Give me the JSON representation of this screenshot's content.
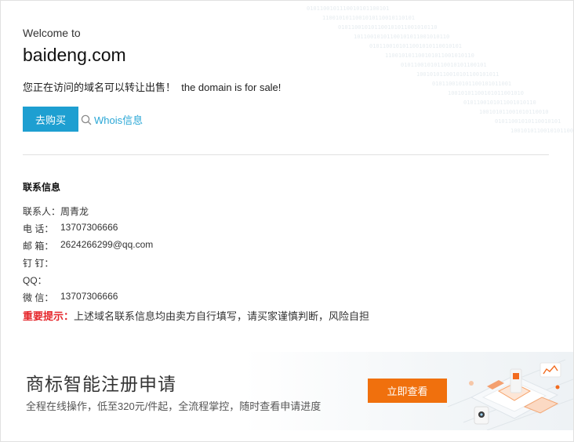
{
  "welcome": "Welcome to",
  "domain": "baideng.com",
  "sale_text": "您正在访问的域名可以转让出售！  the domain is for sale!",
  "buy_button": "去购买",
  "whois_link": "Whois信息",
  "contact": {
    "title": "联系信息",
    "rows": [
      {
        "label": "联系人：",
        "value": "周青龙"
      },
      {
        "label": "电 话：",
        "value": "13707306666"
      },
      {
        "label": "邮 箱：",
        "value": "2624266299@qq.com"
      },
      {
        "label": "钉 钉：",
        "value": ""
      },
      {
        "label": "QQ：",
        "value": ""
      },
      {
        "label": "微 信：",
        "value": "13707306666"
      }
    ]
  },
  "notice": {
    "label": "重要提示：",
    "text": "上述域名联系信息均由卖方自行填写，请买家谨慎判断，风险自担"
  },
  "banner": {
    "title": "商标智能注册申请",
    "subtitle": "全程在线操作，低至320元/件起，全流程掌控，随时查看申请进度",
    "button": "立即查看"
  },
  "colors": {
    "buy_button": "#1e9fd1",
    "whois_link": "#2aa7d6",
    "notice_red": "#e5262b",
    "banner_button": "#f0700d"
  }
}
